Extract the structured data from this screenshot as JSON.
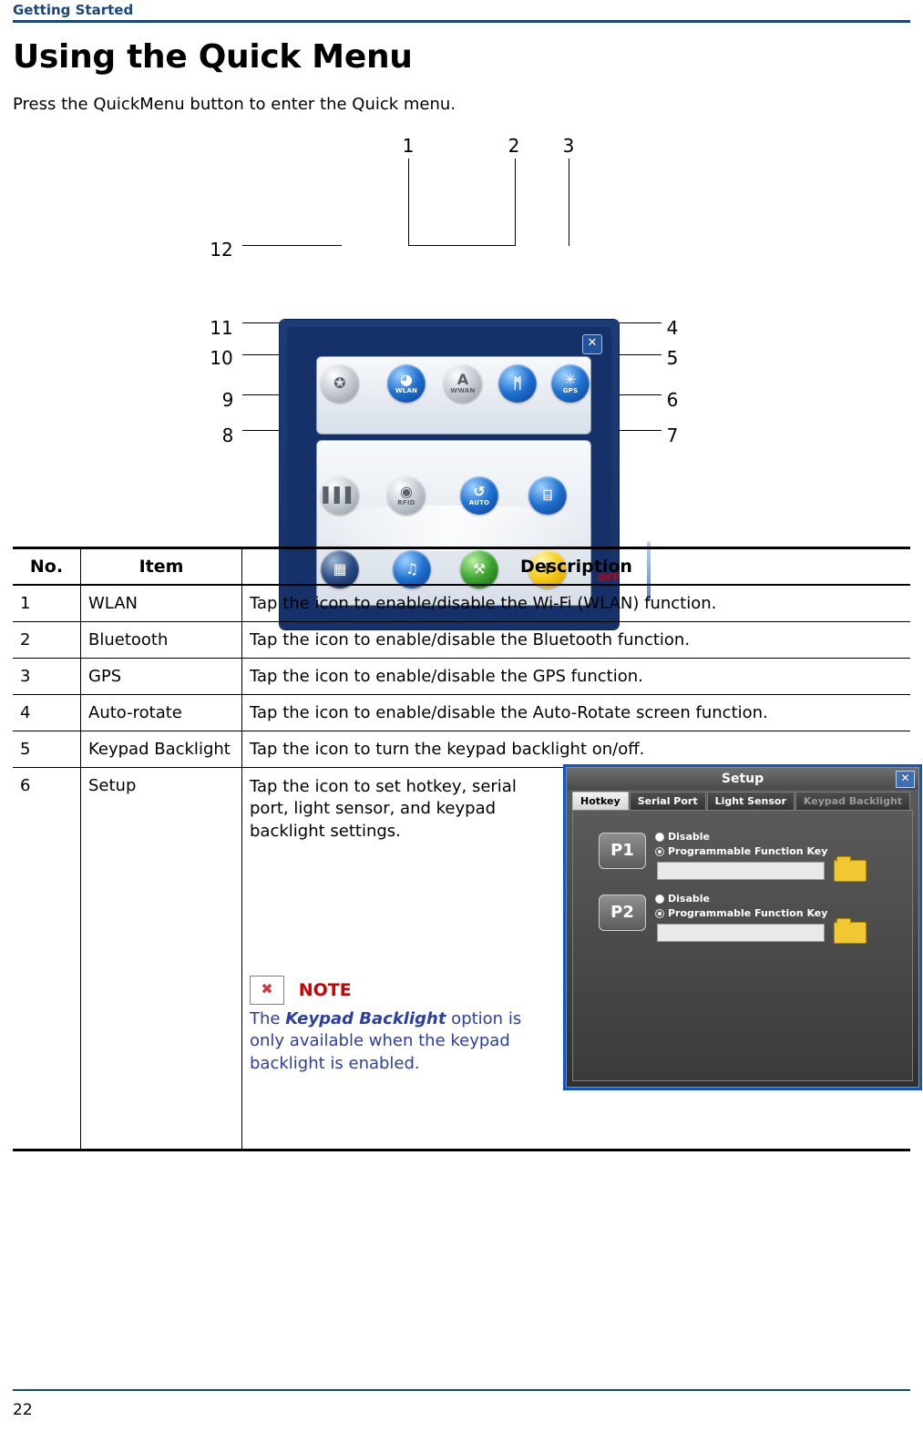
{
  "header": {
    "title": "Getting Started"
  },
  "page": {
    "doc_title": "Using the Quick Menu",
    "intro": "Press the QuickMenu button to enter the Quick menu.",
    "footer_page_number": "22"
  },
  "figure": {
    "callouts": [
      "1",
      "2",
      "3",
      "4",
      "5",
      "6",
      "7",
      "8",
      "9",
      "10",
      "11",
      "12"
    ],
    "quickmenu": {
      "close_label": "✕",
      "off_label": "OFF",
      "icons": [
        {
          "id": "wlan",
          "label": "WLAN",
          "glyph": "◑"
        },
        {
          "id": "wwan",
          "label": "WWAN",
          "glyph": "A"
        },
        {
          "id": "bluetooth",
          "label": "",
          "glyph": "ᛗ"
        },
        {
          "id": "gps",
          "label": "GPS",
          "glyph": "✳"
        },
        {
          "id": "barcode",
          "label": "",
          "glyph": "▐▐"
        },
        {
          "id": "rfid",
          "label": "RFID",
          "glyph": "◉"
        },
        {
          "id": "auto-rotate",
          "label": "AUTO",
          "glyph": "↺"
        },
        {
          "id": "keypad-backlight",
          "label": "",
          "glyph": "⌸"
        },
        {
          "id": "power",
          "label": "",
          "glyph": "☰"
        },
        {
          "id": "volume",
          "label": "",
          "glyph": "♫"
        },
        {
          "id": "setup",
          "label": "",
          "glyph": "⚒"
        },
        {
          "id": "information",
          "label": "",
          "glyph": "i"
        }
      ]
    }
  },
  "table": {
    "headers": [
      "No.",
      "Item",
      "Description"
    ],
    "rows": [
      {
        "no": "1",
        "item": "WLAN",
        "desc": "Tap the icon to enable/disable the Wi-Fi (WLAN) function."
      },
      {
        "no": "2",
        "item": "Bluetooth",
        "desc": "Tap the icon to enable/disable the Bluetooth function."
      },
      {
        "no": "3",
        "item": "GPS",
        "desc": "Tap the icon to enable/disable the GPS function."
      },
      {
        "no": "4",
        "item": "Auto-rotate",
        "desc": "Tap the icon to enable/disable the Auto-Rotate screen function."
      },
      {
        "no": "5",
        "item": "Keypad Backlight",
        "desc": "Tap the icon to turn the keypad backlight on/off."
      },
      {
        "no": "6",
        "item": "Setup",
        "desc": "Tap the icon to set hotkey, serial port, light sensor, and keypad backlight settings."
      }
    ]
  },
  "note": {
    "label": "NOTE",
    "text_before": "The ",
    "bold": "Keypad Backlight",
    "text_after": " option is only available when the keypad backlight is enabled."
  },
  "setup_screenshot": {
    "title": "Setup",
    "close_label": "✕",
    "tabs": [
      {
        "label": "Hotkey",
        "active": true
      },
      {
        "label": "Serial Port",
        "active": false
      },
      {
        "label": "Light Sensor",
        "active": false
      },
      {
        "label": "Keypad Backlight",
        "active": false,
        "dim": true
      }
    ],
    "keys": [
      {
        "name": "P1",
        "option_disable": "Disable",
        "option_pfk": "Programmable Function Key",
        "input_value": ""
      },
      {
        "name": "P2",
        "option_disable": "Disable",
        "option_pfk": "Programmable Function Key",
        "input_value": ""
      }
    ]
  },
  "colors": {
    "accent": "#17477e",
    "note_red": "#cc0000",
    "note_blue": "#2b3fa0"
  }
}
